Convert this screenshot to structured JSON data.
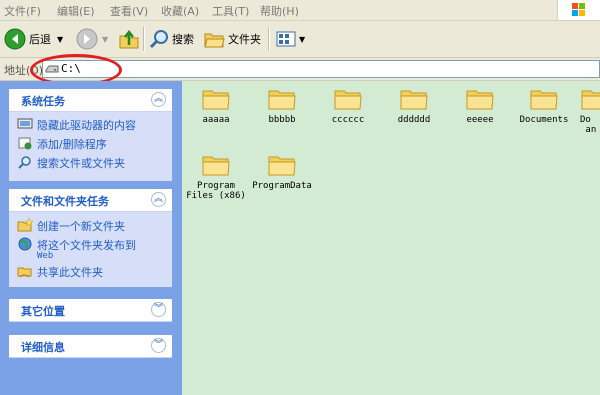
{
  "menu": [
    "文件(F)",
    "编辑(E)",
    "查看(V)",
    "收藏(A)",
    "工具(T)",
    "帮助(H)"
  ],
  "toolbar": {
    "back_label": "后退",
    "search_label": "搜索",
    "folders_label": "文件夹"
  },
  "address": {
    "label": "地址(D)",
    "value": "C:\\"
  },
  "sidebar": {
    "system_tasks": {
      "title": "系统任务",
      "items": [
        {
          "label": "隐藏此驱动器的内容"
        },
        {
          "label": "添加/删除程序"
        },
        {
          "label": "搜索文件或文件夹"
        }
      ]
    },
    "file_tasks": {
      "title": "文件和文件夹任务",
      "items": [
        {
          "label": "创建一个新文件夹"
        },
        {
          "label": "将这个文件夹发布到",
          "sub": "Web"
        },
        {
          "label": "共享此文件夹"
        }
      ]
    },
    "other_places": {
      "title": "其它位置"
    },
    "details": {
      "title": "详细信息"
    }
  },
  "folders": [
    {
      "name": "aaaaa"
    },
    {
      "name": "bbbbb"
    },
    {
      "name": "cccccc"
    },
    {
      "name": "dddddd"
    },
    {
      "name": "eeeee"
    },
    {
      "name": "Documents"
    },
    {
      "name": "Do\n an"
    },
    {
      "name": "Program\nFiles (x86)"
    },
    {
      "name": "ProgramData"
    }
  ]
}
